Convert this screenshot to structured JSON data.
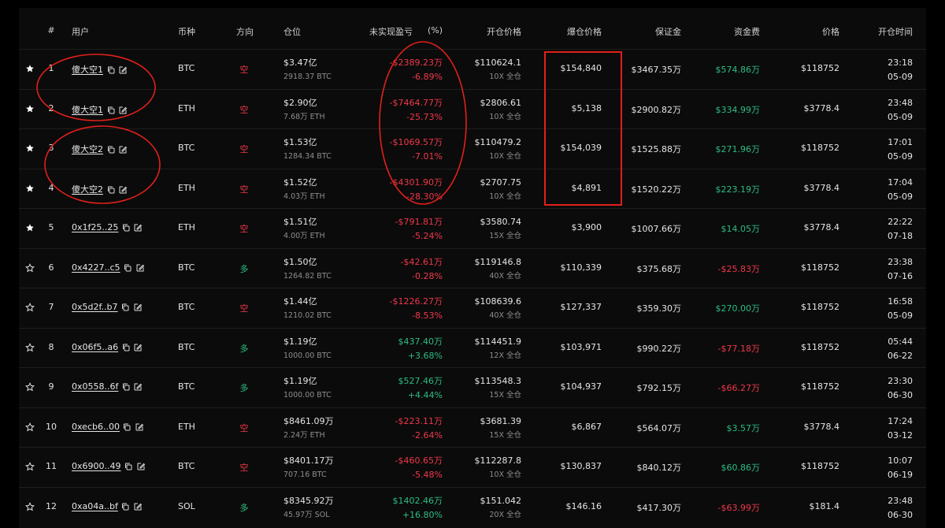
{
  "headers": {
    "idx": "#",
    "user": "用户",
    "coin": "币种",
    "direction": "方向",
    "position": "仓位",
    "pnl": "未实现盈亏",
    "pnl_pct": "(%)",
    "open_price": "开仓价格",
    "liq_price": "爆仓价格",
    "margin": "保证金",
    "funding": "资金费",
    "price": "价格",
    "open_time": "开仓时间"
  },
  "colors": {
    "red": "#f0384a",
    "green": "#2dbd85",
    "annotation": "#e0201a"
  },
  "rows": [
    {
      "starred": true,
      "idx": "1",
      "user": "傻大空1",
      "coin": "BTC",
      "dir": "空",
      "pos": "$3.47亿",
      "pos_sub": "2918.37 BTC",
      "pnl": "-$2389.23万",
      "pnl_pct": "-6.89%",
      "open": "$110624.1",
      "lev": "10X 全仓",
      "liq": "$154,840",
      "margin": "$3467.35万",
      "fund": "$574.86万",
      "price": "$118752",
      "time": "23:18",
      "date": "05-09"
    },
    {
      "starred": true,
      "idx": "2",
      "user": "傻大空1",
      "coin": "ETH",
      "dir": "空",
      "pos": "$2.90亿",
      "pos_sub": "7.68万 ETH",
      "pnl": "-$7464.77万",
      "pnl_pct": "-25.73%",
      "open": "$2806.61",
      "lev": "10X 全仓",
      "liq": "$5,138",
      "margin": "$2900.82万",
      "fund": "$334.99万",
      "price": "$3778.4",
      "time": "23:48",
      "date": "05-09"
    },
    {
      "starred": true,
      "idx": "3",
      "user": "傻大空2",
      "coin": "BTC",
      "dir": "空",
      "pos": "$1.53亿",
      "pos_sub": "1284.34 BTC",
      "pnl": "-$1069.57万",
      "pnl_pct": "-7.01%",
      "open": "$110479.2",
      "lev": "10X 全仓",
      "liq": "$154,039",
      "margin": "$1525.88万",
      "fund": "$271.96万",
      "price": "$118752",
      "time": "17:01",
      "date": "05-09"
    },
    {
      "starred": true,
      "idx": "4",
      "user": "傻大空2",
      "coin": "ETH",
      "dir": "空",
      "pos": "$1.52亿",
      "pos_sub": "4.03万 ETH",
      "pnl": "-$4301.90万",
      "pnl_pct": "-28.30%",
      "open": "$2707.75",
      "lev": "10X 全仓",
      "liq": "$4,891",
      "margin": "$1520.22万",
      "fund": "$223.19万",
      "price": "$3778.4",
      "time": "17:04",
      "date": "05-09"
    },
    {
      "starred": true,
      "idx": "5",
      "user": "0x1f25..25",
      "coin": "ETH",
      "dir": "空",
      "pos": "$1.51亿",
      "pos_sub": "4.00万 ETH",
      "pnl": "-$791.81万",
      "pnl_pct": "-5.24%",
      "open": "$3580.74",
      "lev": "15X 全仓",
      "liq": "$3,900",
      "margin": "$1007.66万",
      "fund": "$14.05万",
      "price": "$3778.4",
      "time": "22:22",
      "date": "07-18"
    },
    {
      "starred": false,
      "idx": "6",
      "user": "0x4227..c5",
      "coin": "BTC",
      "dir": "多",
      "pos": "$1.50亿",
      "pos_sub": "1264.82 BTC",
      "pnl": "-$42.61万",
      "pnl_pct": "-0.28%",
      "open": "$119146.8",
      "lev": "40X 全仓",
      "liq": "$110,339",
      "margin": "$375.68万",
      "fund": "-$25.83万",
      "price": "$118752",
      "time": "23:38",
      "date": "07-16"
    },
    {
      "starred": false,
      "idx": "7",
      "user": "0x5d2f..b7",
      "coin": "BTC",
      "dir": "空",
      "pos": "$1.44亿",
      "pos_sub": "1210.02 BTC",
      "pnl": "-$1226.27万",
      "pnl_pct": "-8.53%",
      "open": "$108639.6",
      "lev": "40X 全仓",
      "liq": "$127,337",
      "margin": "$359.30万",
      "fund": "$270.00万",
      "price": "$118752",
      "time": "16:58",
      "date": "05-09"
    },
    {
      "starred": false,
      "idx": "8",
      "user": "0x06f5..a6",
      "coin": "BTC",
      "dir": "多",
      "pos": "$1.19亿",
      "pos_sub": "1000.00 BTC",
      "pnl": "$437.40万",
      "pnl_pct": "+3.68%",
      "open": "$114451.9",
      "lev": "12X 全仓",
      "liq": "$103,971",
      "margin": "$990.22万",
      "fund": "-$77.18万",
      "price": "$118752",
      "time": "05:44",
      "date": "06-22"
    },
    {
      "starred": false,
      "idx": "9",
      "user": "0x0558..6f",
      "coin": "BTC",
      "dir": "多",
      "pos": "$1.19亿",
      "pos_sub": "1000.00 BTC",
      "pnl": "$527.46万",
      "pnl_pct": "+4.44%",
      "open": "$113548.3",
      "lev": "15X 全仓",
      "liq": "$104,937",
      "margin": "$792.15万",
      "fund": "-$66.27万",
      "price": "$118752",
      "time": "23:30",
      "date": "06-30"
    },
    {
      "starred": false,
      "idx": "10",
      "user": "0xecb6..00",
      "coin": "ETH",
      "dir": "空",
      "pos": "$8461.09万",
      "pos_sub": "2.24万 ETH",
      "pnl": "-$223.11万",
      "pnl_pct": "-2.64%",
      "open": "$3681.39",
      "lev": "15X 全仓",
      "liq": "$6,867",
      "margin": "$564.07万",
      "fund": "$3.57万",
      "price": "$3778.4",
      "time": "17:24",
      "date": "03-12"
    },
    {
      "starred": false,
      "idx": "11",
      "user": "0x6900..49",
      "coin": "BTC",
      "dir": "空",
      "pos": "$8401.17万",
      "pos_sub": "707.16 BTC",
      "pnl": "-$460.65万",
      "pnl_pct": "-5.48%",
      "open": "$112287.8",
      "lev": "10X 全仓",
      "liq": "$130,837",
      "margin": "$840.12万",
      "fund": "$60.86万",
      "price": "$118752",
      "time": "10:07",
      "date": "06-19"
    },
    {
      "starred": false,
      "idx": "12",
      "user": "0xa04a..bf",
      "coin": "SOL",
      "dir": "多",
      "pos": "$8345.92万",
      "pos_sub": "45.97万 SOL",
      "pnl": "$1402.46万",
      "pnl_pct": "+16.80%",
      "open": "$151.042",
      "lev": "20X 全仓",
      "liq": "$146.16",
      "margin": "$417.30万",
      "fund": "-$63.99万",
      "price": "$181.4",
      "time": "23:48",
      "date": "06-30"
    }
  ]
}
